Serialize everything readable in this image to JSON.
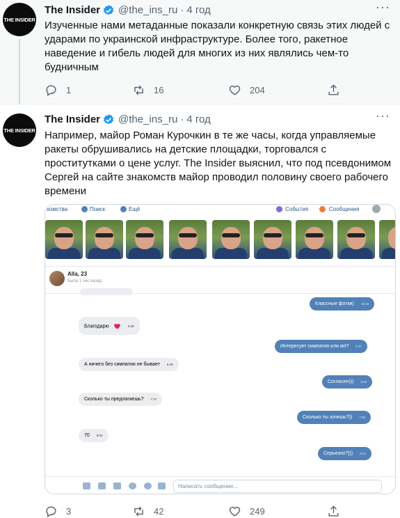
{
  "tweets": [
    {
      "avatar_text": "THE INSIDER",
      "name": "The Insider",
      "handle": "@the_ins_ru",
      "time": "4 год",
      "text": "Изученные нами метаданные показали конкретную связь этих людей с ударами по украинской инфраструктуре. Более того, ракетное наведение и гибель людей для многих из них являлись чем-то будничным",
      "replies": "1",
      "retweets": "16",
      "likes": "204"
    },
    {
      "avatar_text": "THE INSIDER",
      "name": "The Insider",
      "handle": "@the_ins_ru",
      "time": "4 год",
      "text": "Например, майор Роман Курочкин в те же часы, когда управляемые ракеты обрушивались на детские площадки, торговался с проститутками о цене услуг. The Insider выяснил, что под псевдонимом Сергей на сайте знакомств майор проводил половину своего рабочего времени",
      "replies": "3",
      "retweets": "42",
      "likes": "249"
    }
  ],
  "media": {
    "nav": [
      "хомства",
      "Поиск",
      "Ещё",
      "События",
      "Сообщения"
    ],
    "chat_user": "Alla, 23",
    "chat_status": "Была 1 час назад",
    "messages": [
      {
        "dir": "out",
        "text": "Классные фотки)",
        "time": "15:15"
      },
      {
        "dir": "in",
        "text": "Благодарю",
        "time": "4:46"
      },
      {
        "dir": "out",
        "text": "Интересует симпатия или мп?",
        "time": "5:37"
      },
      {
        "dir": "in",
        "text": "А ничего без симпатии не бывает",
        "time": "6:45"
      },
      {
        "dir": "out",
        "text": "Согласен)))",
        "time": "6:54"
      },
      {
        "dir": "in",
        "text": "Сколько ты предлагаешь?",
        "time": "7:47"
      },
      {
        "dir": "out",
        "text": "Сколько ты хочешь?))",
        "time": "7:59"
      },
      {
        "dir": "in",
        "text": "70",
        "time": "8:02"
      },
      {
        "dir": "out",
        "text": "Серьезно?)))",
        "time": "8:13"
      }
    ],
    "composer_placeholder": "Написать сообщение..."
  },
  "colors": {
    "accent": "#1d9bf0",
    "vk_blue": "#5181b8",
    "secondary_text": "#536471",
    "heart": "#e0245e"
  },
  "icons": [
    "verified-badge-icon",
    "more-icon",
    "reply-icon",
    "retweet-icon",
    "like-icon",
    "share-icon",
    "heart-icon"
  ]
}
